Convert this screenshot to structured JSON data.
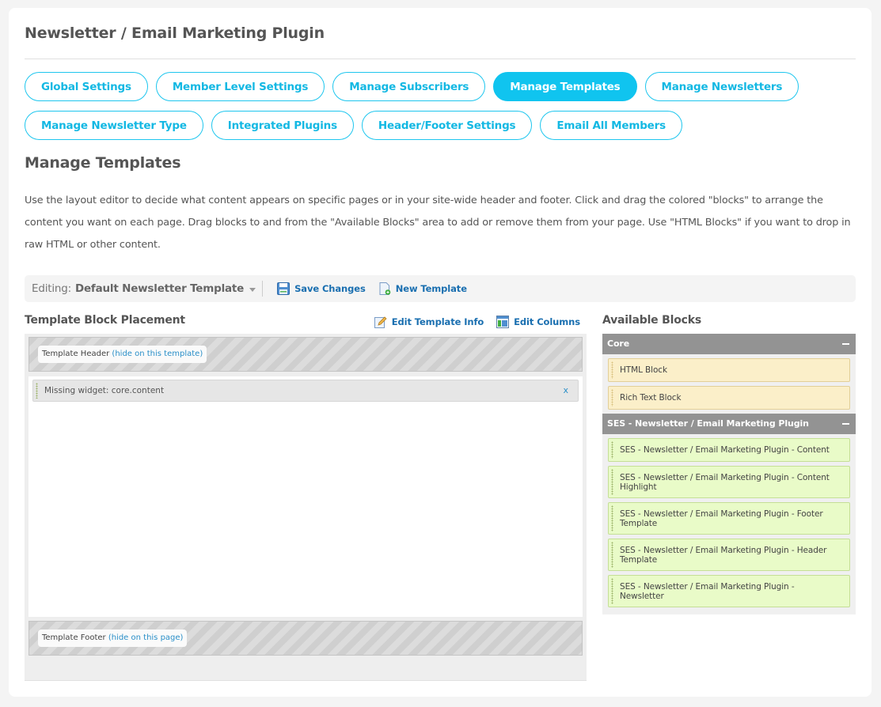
{
  "page": {
    "title": "Newsletter / Email Marketing Plugin"
  },
  "tabs": {
    "row1": [
      {
        "label": "Global Settings",
        "active": false
      },
      {
        "label": "Member Level Settings",
        "active": false
      },
      {
        "label": "Manage Subscribers",
        "active": false
      },
      {
        "label": "Manage Templates",
        "active": true
      },
      {
        "label": "Manage Newsletters",
        "active": false
      }
    ],
    "row2": [
      {
        "label": "Manage Newsletter Type",
        "active": false
      },
      {
        "label": "Integrated Plugins",
        "active": false
      },
      {
        "label": "Header/Footer Settings",
        "active": false
      },
      {
        "label": "Email All Members",
        "active": false
      }
    ]
  },
  "section": {
    "title": "Manage Templates",
    "description": "Use the layout editor to decide what content appears on specific pages or in your site-wide header and footer. Click and drag the colored \"blocks\" to arrange the content you want on each page. Drag blocks to and from the \"Available Blocks\" area to add or remove them from your page. Use \"HTML Blocks\" if you want to drop in raw HTML or other content."
  },
  "editbar": {
    "editing_label": "Editing:",
    "template_name": "Default Newsletter Template",
    "save_label": "Save Changes",
    "new_label": "New Template"
  },
  "placement": {
    "title": "Template Block Placement",
    "edit_info_label": "Edit Template Info",
    "edit_columns_label": "Edit Columns",
    "header_label": "Template Header",
    "header_link": "(hide on this template)",
    "widget_text": "Missing widget: core.content",
    "widget_remove": "x",
    "footer_label": "Template Footer",
    "footer_link": "(hide on this page)"
  },
  "available": {
    "title": "Available Blocks",
    "groups": [
      {
        "name": "Core",
        "blocks": [
          "HTML Block",
          "Rich Text Block"
        ]
      },
      {
        "name": "SES - Newsletter / Email Marketing Plugin",
        "blocks": [
          "SES - Newsletter / Email Marketing Plugin - Content",
          "SES - Newsletter / Email Marketing Plugin - Content Highlight",
          "SES - Newsletter / Email Marketing Plugin - Footer Template",
          "SES - Newsletter / Email Marketing Plugin - Header Template",
          "SES - Newsletter / Email Marketing Plugin - Newsletter"
        ]
      }
    ]
  },
  "colors": {
    "accent": "#10c4ef",
    "link": "#1a6fb0",
    "core_block": "#fbefc9",
    "ses_block": "#e9fbc8",
    "group_header": "#939393"
  }
}
